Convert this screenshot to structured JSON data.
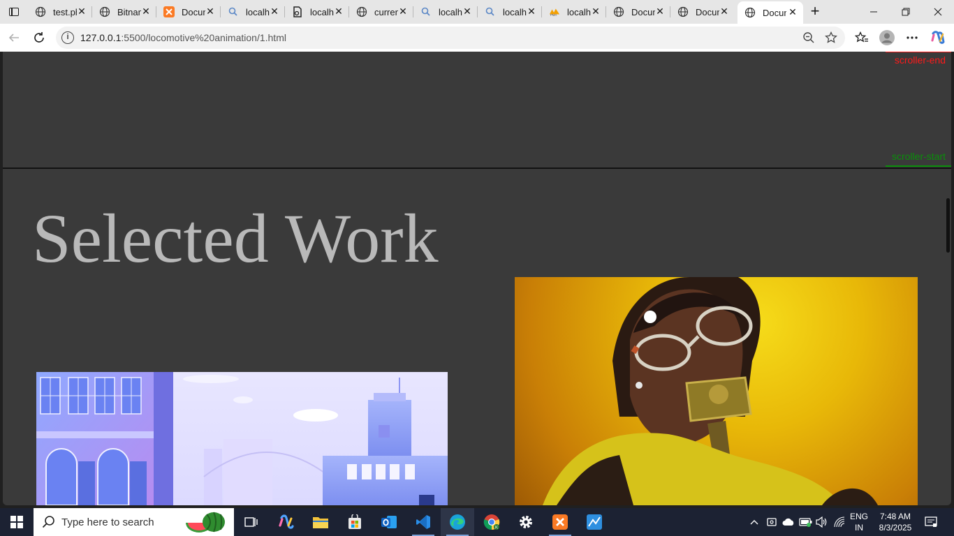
{
  "browser": {
    "tabs": [
      {
        "title": "test.php",
        "icon": "globe-icon"
      },
      {
        "title": "Bitnami",
        "icon": "globe-icon"
      },
      {
        "title": "Document",
        "icon": "xampp-icon"
      },
      {
        "title": "localhost",
        "icon": "search-icon"
      },
      {
        "title": "localhost",
        "icon": "file-icon"
      },
      {
        "title": "currency",
        "icon": "globe-icon"
      },
      {
        "title": "localhost",
        "icon": "search-icon"
      },
      {
        "title": "localhost",
        "icon": "search-icon"
      },
      {
        "title": "localhost",
        "icon": "phpmyadmin-icon"
      },
      {
        "title": "Document",
        "icon": "globe-icon"
      },
      {
        "title": "Document",
        "icon": "globe-icon"
      },
      {
        "title": "Document",
        "icon": "globe-icon",
        "active": true
      }
    ],
    "address": {
      "host": "127.0.0.1",
      "path": ":5500/locomotive%20animation/1.html"
    }
  },
  "page": {
    "marker_end": "scroller-end",
    "marker_start": "scroller-start",
    "heading": "Selected Work",
    "colors": {
      "background": "#3a3a3a",
      "heading": "#b9b9b9",
      "marker_end": "#ff1a1a",
      "marker_start": "#0a8f0a"
    }
  },
  "taskbar": {
    "search_placeholder": "Type here to search",
    "language_line1": "ENG",
    "language_line2": "IN",
    "time": "7:48 AM",
    "date": "8/3/2025"
  }
}
